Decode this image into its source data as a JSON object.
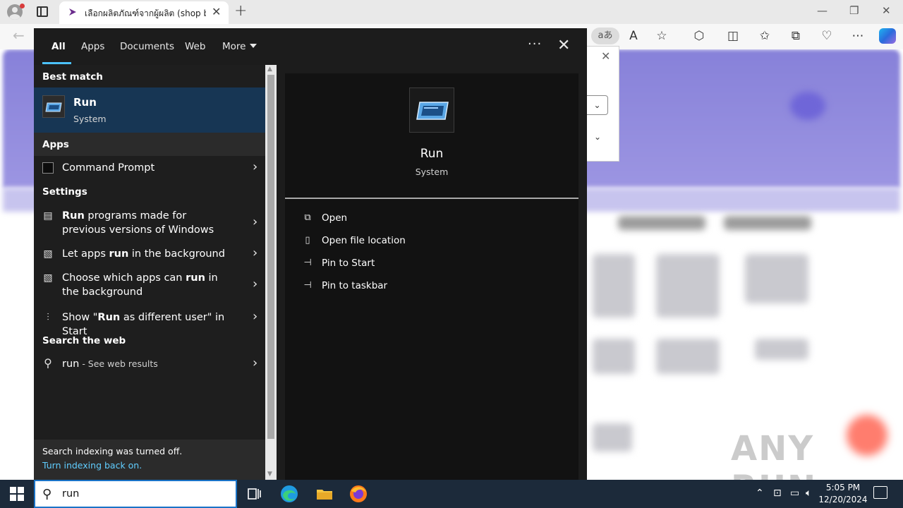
{
  "browser": {
    "tab_title": "เลือกผลิตภัณฑ์จากผู้ผลิต (shop by b",
    "new_tab_glyph": "+",
    "translate_label": "aあ",
    "accent": "#1a73c7"
  },
  "search_panel": {
    "filters": [
      "All",
      "Apps",
      "Documents",
      "Web",
      "More"
    ],
    "more_options": "···",
    "best_match_heading": "Best match",
    "best_match": {
      "title": "Run",
      "subtitle": "System"
    },
    "apps_heading": "Apps",
    "apps": [
      {
        "label": "Command Prompt"
      }
    ],
    "settings_heading": "Settings",
    "settings": [
      {
        "bold": "Run",
        "rest": " programs made for previous versions of Windows"
      },
      {
        "pre": "Let apps ",
        "bold": "run",
        "rest": " in the background"
      },
      {
        "pre": "Choose which apps can ",
        "bold": "run",
        "rest": " in the background"
      },
      {
        "pre": "Show \"",
        "bold": "Run",
        "rest": " as different user\" in Start"
      }
    ],
    "web_heading": "Search the web",
    "web": {
      "query": "run",
      "suffix": " - See web results"
    },
    "indexing_message": "Search indexing was turned off.",
    "indexing_link": "Turn indexing back on.",
    "preview": {
      "title": "Run",
      "subtitle": "System",
      "actions": [
        "Open",
        "Open file location",
        "Pin to Start",
        "Pin to taskbar"
      ]
    }
  },
  "taskbar": {
    "search_value": "run",
    "time": "5:05 PM",
    "date": "12/20/2024"
  },
  "watermark": "ANY RUN"
}
